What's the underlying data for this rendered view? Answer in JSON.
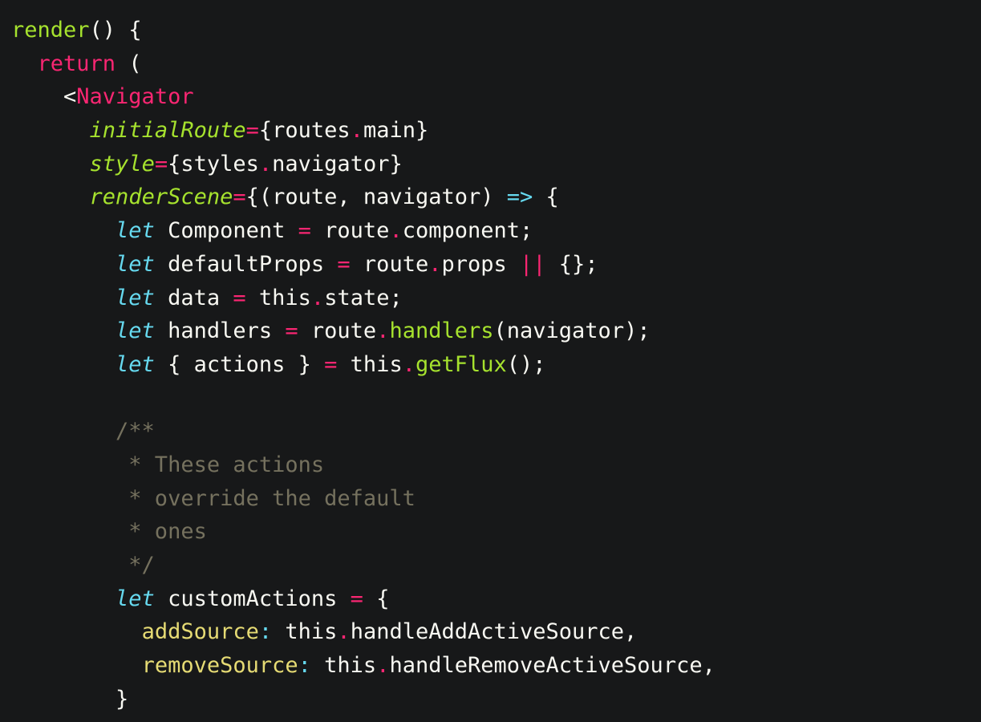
{
  "theme": {
    "background": "#171819",
    "plain": "#f8f8f2",
    "keyword": "#f92672",
    "function": "#a6e22e",
    "storage": "#66d9ef",
    "comment": "#75715e",
    "object_key": "#e6db74"
  },
  "lines": [
    [
      {
        "t": "render",
        "c": "fn"
      },
      {
        "t": "() {",
        "c": "plain"
      }
    ],
    [
      {
        "t": "  ",
        "c": "plain"
      },
      {
        "t": "return",
        "c": "kw"
      },
      {
        "t": " (",
        "c": "plain"
      }
    ],
    [
      {
        "t": "    <",
        "c": "plain"
      },
      {
        "t": "Navigator",
        "c": "tag"
      }
    ],
    [
      {
        "t": "      ",
        "c": "plain"
      },
      {
        "t": "initialRoute",
        "c": "attr"
      },
      {
        "t": "=",
        "c": "op"
      },
      {
        "t": "{routes",
        "c": "plain"
      },
      {
        "t": ".",
        "c": "op"
      },
      {
        "t": "main}",
        "c": "plain"
      }
    ],
    [
      {
        "t": "      ",
        "c": "plain"
      },
      {
        "t": "style",
        "c": "attr"
      },
      {
        "t": "=",
        "c": "op"
      },
      {
        "t": "{styles",
        "c": "plain"
      },
      {
        "t": ".",
        "c": "op"
      },
      {
        "t": "navigator}",
        "c": "plain"
      }
    ],
    [
      {
        "t": "      ",
        "c": "plain"
      },
      {
        "t": "renderScene",
        "c": "attr"
      },
      {
        "t": "=",
        "c": "op"
      },
      {
        "t": "{(route, navigator) ",
        "c": "plain"
      },
      {
        "t": "=>",
        "c": "arrow"
      },
      {
        "t": " {",
        "c": "plain"
      }
    ],
    [
      {
        "t": "        ",
        "c": "plain"
      },
      {
        "t": "let",
        "c": "storage"
      },
      {
        "t": " Component ",
        "c": "plain"
      },
      {
        "t": "=",
        "c": "op"
      },
      {
        "t": " route",
        "c": "plain"
      },
      {
        "t": ".",
        "c": "op"
      },
      {
        "t": "component;",
        "c": "plain"
      }
    ],
    [
      {
        "t": "        ",
        "c": "plain"
      },
      {
        "t": "let",
        "c": "storage"
      },
      {
        "t": " defaultProps ",
        "c": "plain"
      },
      {
        "t": "=",
        "c": "op"
      },
      {
        "t": " route",
        "c": "plain"
      },
      {
        "t": ".",
        "c": "op"
      },
      {
        "t": "props ",
        "c": "plain"
      },
      {
        "t": "||",
        "c": "op"
      },
      {
        "t": " {};",
        "c": "plain"
      }
    ],
    [
      {
        "t": "        ",
        "c": "plain"
      },
      {
        "t": "let",
        "c": "storage"
      },
      {
        "t": " data ",
        "c": "plain"
      },
      {
        "t": "=",
        "c": "op"
      },
      {
        "t": " this",
        "c": "plain"
      },
      {
        "t": ".",
        "c": "op"
      },
      {
        "t": "state;",
        "c": "plain"
      }
    ],
    [
      {
        "t": "        ",
        "c": "plain"
      },
      {
        "t": "let",
        "c": "storage"
      },
      {
        "t": " handlers ",
        "c": "plain"
      },
      {
        "t": "=",
        "c": "op"
      },
      {
        "t": " route",
        "c": "plain"
      },
      {
        "t": ".",
        "c": "op"
      },
      {
        "t": "handlers",
        "c": "method"
      },
      {
        "t": "(navigator);",
        "c": "plain"
      }
    ],
    [
      {
        "t": "        ",
        "c": "plain"
      },
      {
        "t": "let",
        "c": "storage"
      },
      {
        "t": " { actions } ",
        "c": "plain"
      },
      {
        "t": "=",
        "c": "op"
      },
      {
        "t": " this",
        "c": "plain"
      },
      {
        "t": ".",
        "c": "op"
      },
      {
        "t": "getFlux",
        "c": "method"
      },
      {
        "t": "();",
        "c": "plain"
      }
    ],
    [],
    [
      {
        "t": "        /**",
        "c": "comment"
      }
    ],
    [
      {
        "t": "         * These actions",
        "c": "comment"
      }
    ],
    [
      {
        "t": "         * override the default",
        "c": "comment"
      }
    ],
    [
      {
        "t": "         * ones",
        "c": "comment"
      }
    ],
    [
      {
        "t": "         */",
        "c": "comment"
      }
    ],
    [
      {
        "t": "        ",
        "c": "plain"
      },
      {
        "t": "let",
        "c": "storage"
      },
      {
        "t": " customActions ",
        "c": "plain"
      },
      {
        "t": "=",
        "c": "op"
      },
      {
        "t": " {",
        "c": "plain"
      }
    ],
    [
      {
        "t": "          ",
        "c": "plain"
      },
      {
        "t": "addSource",
        "c": "key"
      },
      {
        "t": ":",
        "c": "colon"
      },
      {
        "t": " this",
        "c": "plain"
      },
      {
        "t": ".",
        "c": "op"
      },
      {
        "t": "handleAddActiveSource,",
        "c": "plain"
      }
    ],
    [
      {
        "t": "          ",
        "c": "plain"
      },
      {
        "t": "removeSource",
        "c": "key"
      },
      {
        "t": ":",
        "c": "colon"
      },
      {
        "t": " this",
        "c": "plain"
      },
      {
        "t": ".",
        "c": "op"
      },
      {
        "t": "handleRemoveActiveSource,",
        "c": "plain"
      }
    ],
    [
      {
        "t": "        }",
        "c": "plain"
      }
    ]
  ]
}
